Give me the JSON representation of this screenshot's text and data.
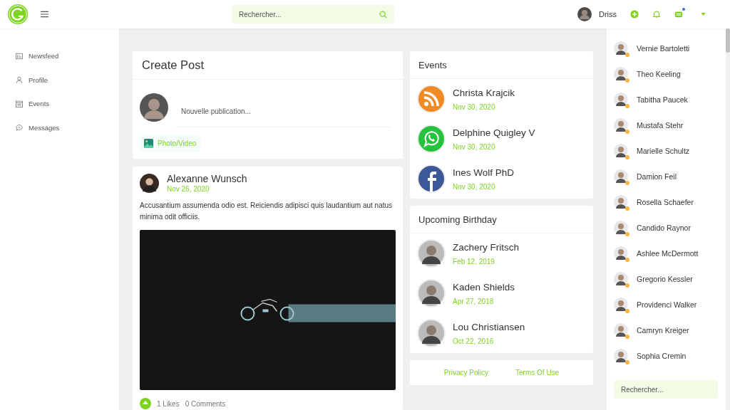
{
  "topbar": {
    "search": {
      "placeholder": "Rechercher..."
    },
    "user": {
      "name": "Driss"
    },
    "messages_unread": true
  },
  "sidebar": {
    "items": [
      {
        "label": "Newsfeed",
        "kind": "news"
      },
      {
        "label": "Profile",
        "kind": "person"
      },
      {
        "label": "Events",
        "kind": "calendar"
      },
      {
        "label": "Messages",
        "kind": "chat"
      }
    ]
  },
  "create_post": {
    "title": "Create Post",
    "placeholder": "Nouvelle publication...",
    "media_button": "Photo/Video"
  },
  "post": {
    "author": "Alexanne Wunsch",
    "date": "Nov 26, 2020",
    "text": "Accusantium assumenda odio est. Reiciendis adipisci quis laudantium aut natus minima odit officiis.",
    "likes": "1 Likes",
    "comments": "0 Comments"
  },
  "events": {
    "title": "Events",
    "items": [
      {
        "name": "Christa Krajcik",
        "date": "Nov 30, 2020",
        "kind": "rss"
      },
      {
        "name": "Delphine Quigley V",
        "date": "Nov 30, 2020",
        "kind": "whatsapp"
      },
      {
        "name": "Ines Wolf PhD",
        "date": "Nov 30, 2020",
        "kind": "facebook"
      }
    ]
  },
  "birthdays": {
    "title": "Upcoming Birthday",
    "items": [
      {
        "name": "Zachery Fritsch",
        "date": "Feb 12, 2019"
      },
      {
        "name": "Kaden Shields",
        "date": "Apr 27, 2018"
      },
      {
        "name": "Lou Christiansen",
        "date": "Oct 22, 2016"
      }
    ]
  },
  "footer": {
    "links": [
      "Privacy Policy",
      "Terms Of Use"
    ]
  },
  "contacts": {
    "items": [
      "Vernie Bartoletti",
      "Theo Keeling",
      "Tabitha Paucek",
      "Mustafa Stehr",
      "Marielle Schultz",
      "Damion Feil",
      "Rosella Schaefer",
      "Candido Raynor",
      "Ashlee McDermott",
      "Gregorio Kessler",
      "Providenci Walker",
      "Camryn Kreiger",
      "Sophia Cremin"
    ],
    "search": {
      "placeholder": "Rechercher..."
    }
  }
}
